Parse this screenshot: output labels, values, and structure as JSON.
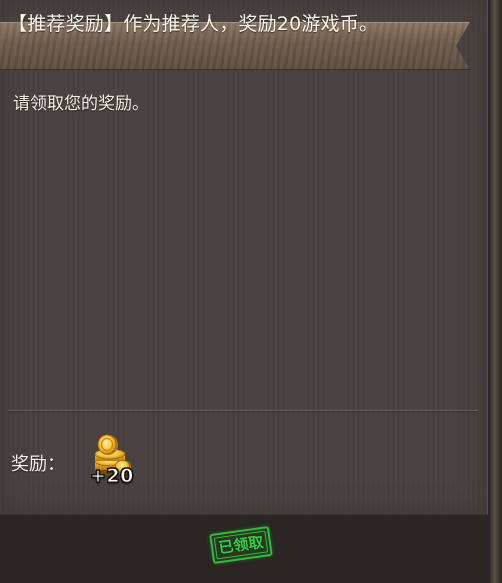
{
  "mail": {
    "title": "【推荐奖励】作为推荐人，奖励20游戏币。",
    "body": "请领取您的奖励。",
    "reward_label": "奖励：",
    "reward": {
      "icon": "gold-coins-icon",
      "amount_text": "+20"
    },
    "status_stamp": "已领取"
  },
  "colors": {
    "panel_bg": "#4a4240",
    "title_banner": "#6d5a4c",
    "stamp_green": "#2fbd3a"
  }
}
